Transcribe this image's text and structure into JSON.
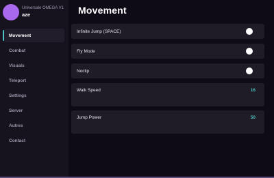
{
  "profile": {
    "app_title": "Universale OMEGA V1",
    "user_name": "aze",
    "avatar_color": "#a969ee"
  },
  "sidebar": {
    "items": [
      {
        "label": "Movement",
        "active": true
      },
      {
        "label": "Combat",
        "active": false
      },
      {
        "label": "Visuals",
        "active": false
      },
      {
        "label": "Teleport",
        "active": false
      },
      {
        "label": "Settings",
        "active": false
      },
      {
        "label": "Server",
        "active": false
      },
      {
        "label": "Autres",
        "active": false
      },
      {
        "label": "Contact",
        "active": false
      }
    ]
  },
  "main": {
    "title": "Movement",
    "toggles": [
      {
        "label": "Infinite Jump (SPACE)",
        "icon": "toggle-knob"
      },
      {
        "label": "Fly Mode",
        "icon": "toggle-knob"
      },
      {
        "label": "Noclip",
        "icon": "toggle-knob"
      }
    ],
    "sliders": [
      {
        "label": "Walk Speed",
        "value": "16"
      },
      {
        "label": "Jump Power",
        "value": "50"
      }
    ]
  },
  "colors": {
    "accent": "#4ec3c2",
    "background": "#0e0b16",
    "sidebar": "#16131f",
    "card": "#1f1c27"
  }
}
